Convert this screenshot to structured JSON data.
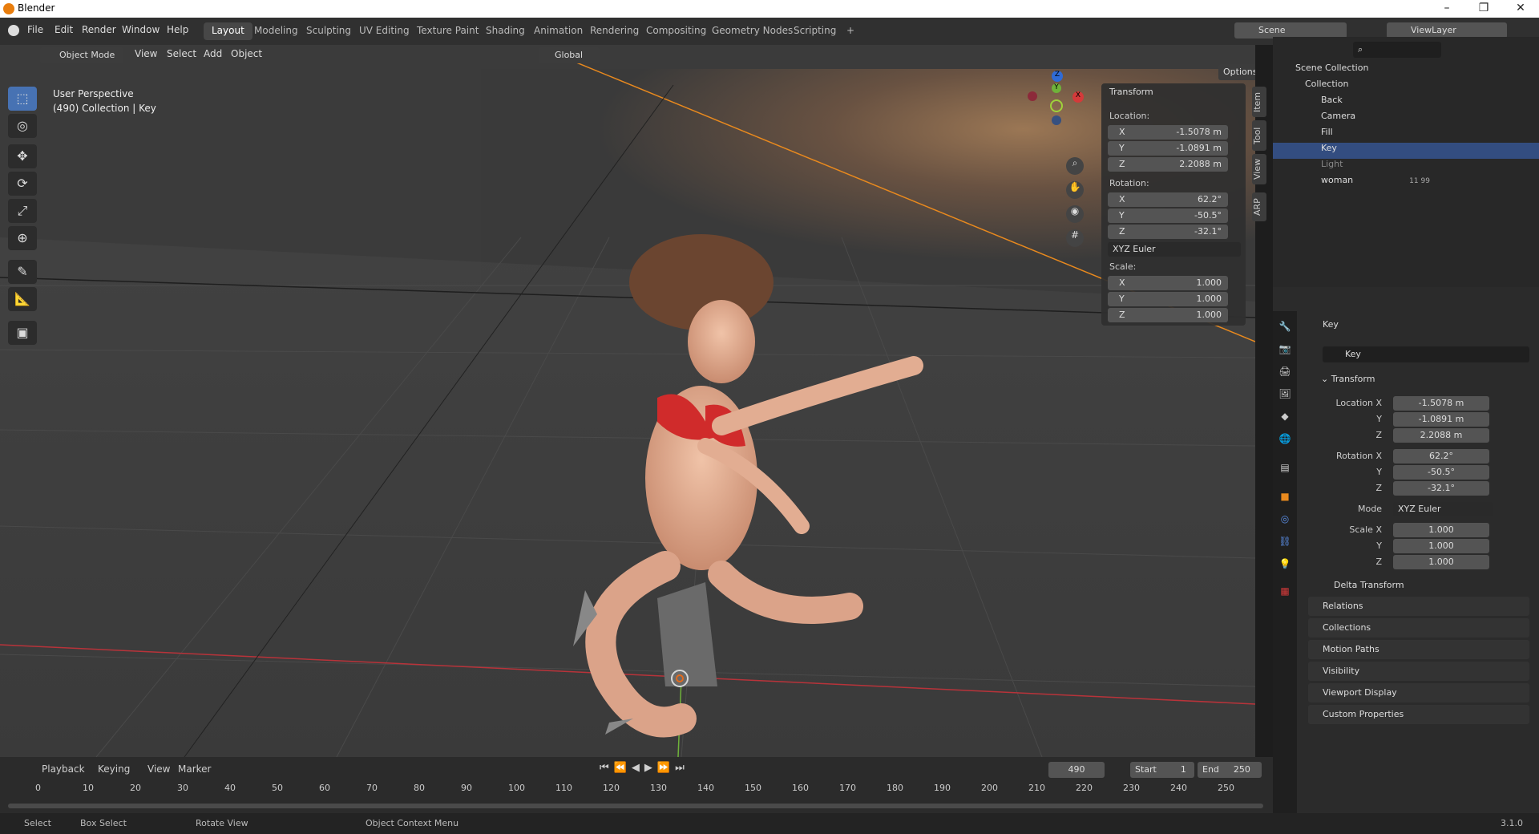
{
  "window": {
    "title": "Blender"
  },
  "menubar": {
    "menus": [
      "File",
      "Edit",
      "Render",
      "Window",
      "Help"
    ],
    "workspaces": [
      "Layout",
      "Modeling",
      "Sculpting",
      "UV Editing",
      "Texture Paint",
      "Shading",
      "Animation",
      "Rendering",
      "Compositing",
      "Geometry Nodes",
      "Scripting",
      "+"
    ],
    "active_workspace": "Layout",
    "scene": "Scene",
    "view_layer": "ViewLayer"
  },
  "viewport_header": {
    "mode": "Object Mode",
    "menus": [
      "View",
      "Select",
      "Add",
      "Object"
    ],
    "orientation": "Global",
    "options": "Options"
  },
  "viewport": {
    "perspective": "User Perspective",
    "info": "(490) Collection | Key",
    "gizmo_axes": [
      "X",
      "Y",
      "Z"
    ]
  },
  "npanel": {
    "title": "Transform",
    "location_label": "Location:",
    "rotation_label": "Rotation:",
    "scale_label": "Scale:",
    "axes": [
      "X",
      "Y",
      "Z"
    ],
    "location": [
      "-1.5078 m",
      "-1.0891 m",
      "2.2088 m"
    ],
    "rotation": [
      "62.2°",
      "-50.5°",
      "-32.1°"
    ],
    "rotation_mode": "XYZ Euler",
    "scale": [
      "1.000",
      "1.000",
      "1.000"
    ],
    "tabs": [
      "Item",
      "Tool",
      "View",
      "ARP"
    ]
  },
  "outliner": {
    "root": "Scene Collection",
    "collection": "Collection",
    "items": [
      "Back",
      "Camera",
      "Fill",
      "Key",
      "Light",
      "woman"
    ],
    "selected": "Key",
    "woman_badge": "11 99"
  },
  "properties": {
    "object_name": "Key",
    "data_name": "Key",
    "transform_title": "Transform",
    "location_label": "Location X",
    "rotation_label": "Rotation X",
    "scale_label": "Scale X",
    "mode_label": "Mode",
    "y": "Y",
    "z": "Z",
    "location": [
      "-1.5078 m",
      "-1.0891 m",
      "2.2088 m"
    ],
    "rotation": [
      "62.2°",
      "-50.5°",
      "-32.1°"
    ],
    "mode": "XYZ Euler",
    "scale": [
      "1.000",
      "1.000",
      "1.000"
    ],
    "sections": [
      "Delta Transform",
      "Relations",
      "Collections",
      "Motion Paths",
      "Visibility",
      "Viewport Display",
      "Custom Properties"
    ]
  },
  "timeline": {
    "menus": [
      "Playback",
      "Keying",
      "View",
      "Marker"
    ],
    "current_frame": "490",
    "start_label": "Start",
    "start": "1",
    "end_label": "End",
    "end": "250",
    "ticks": [
      "0",
      "10",
      "20",
      "30",
      "40",
      "50",
      "60",
      "70",
      "80",
      "90",
      "100",
      "110",
      "120",
      "130",
      "140",
      "150",
      "160",
      "170",
      "180",
      "190",
      "200",
      "210",
      "220",
      "230",
      "240",
      "250"
    ]
  },
  "statusbar": {
    "select": "Select",
    "box_select": "Box Select",
    "rotate": "Rotate View",
    "context": "Object Context Menu",
    "version": "3.1.0"
  }
}
